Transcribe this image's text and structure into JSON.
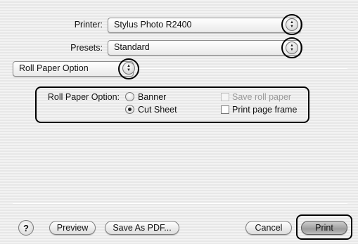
{
  "printer": {
    "label": "Printer:",
    "value": "Stylus Photo R2400",
    "arrows_icon": "updown-arrows-icon"
  },
  "presets": {
    "label": "Presets:",
    "value": "Standard"
  },
  "panel_menu": {
    "value": "Roll Paper Option"
  },
  "roll_paper": {
    "group_label": "Roll Paper Option:",
    "options": [
      {
        "label": "Banner",
        "selected": false
      },
      {
        "label": "Cut Sheet",
        "selected": true
      }
    ],
    "checkboxes": [
      {
        "label": "Save roll paper",
        "checked": false,
        "enabled": false
      },
      {
        "label": "Print page frame",
        "checked": false,
        "enabled": true
      }
    ]
  },
  "footer": {
    "help_label": "?",
    "preview_label": "Preview",
    "save_pdf_label": "Save As PDF...",
    "cancel_label": "Cancel",
    "print_label": "Print"
  },
  "colors": {
    "highlight": "#000000",
    "background_stripe": "#e7e7e7"
  }
}
